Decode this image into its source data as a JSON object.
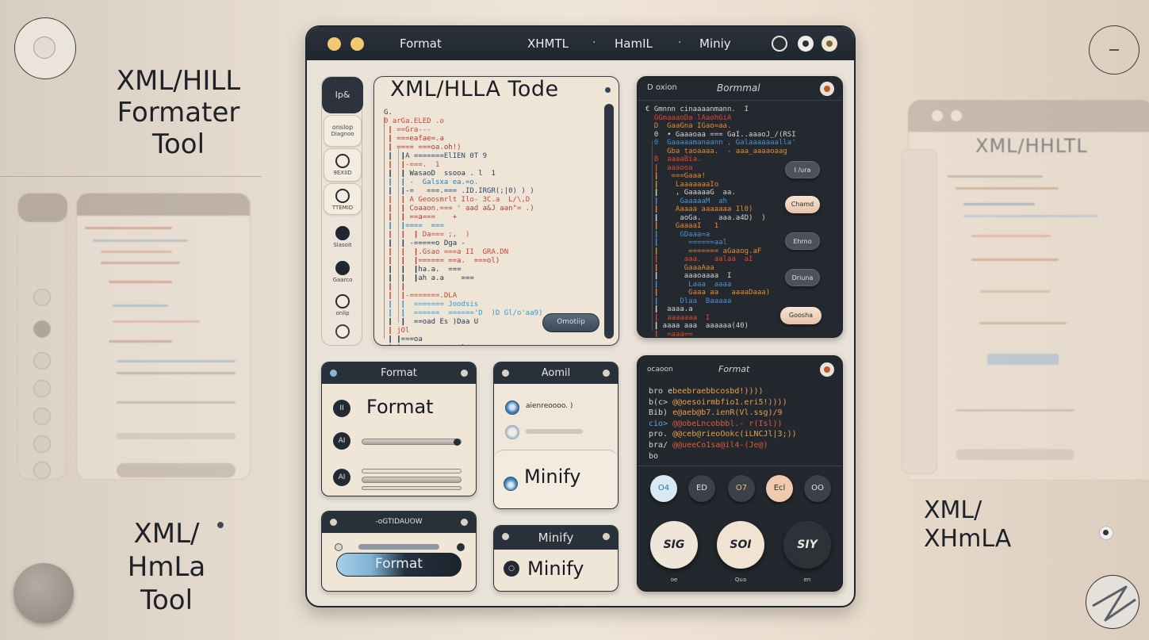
{
  "backdrop": {
    "left_heading": [
      "XML/HILL",
      "Formater",
      "Tool"
    ],
    "left_bottom_heading": [
      "XML/",
      "HmLa",
      "Tool"
    ],
    "right_ghost_title": "XML/HHLTL",
    "right_bottom_heading": [
      "XML/",
      "XHmLA"
    ]
  },
  "window": {
    "toolbar": {
      "format_label": "Format",
      "tabs": [
        "XHMTL",
        "HamIL",
        "Miniy"
      ],
      "separator": "·",
      "icons": [
        "refresh-icon",
        "record-icon",
        "settings-icon"
      ]
    },
    "sidebar": {
      "top_label": "Ip&",
      "items": [
        {
          "label": "onslop",
          "sublabel": "Diagnoo",
          "icon": "text"
        },
        {
          "label": "9EXIID",
          "icon": "circle-outline"
        },
        {
          "label": "TTEMID",
          "icon": "circle-outline"
        },
        {
          "label": "Slasoit",
          "icon": "circle-filled"
        },
        {
          "label": "Gaarco",
          "icon": "circle-filled"
        },
        {
          "label": "onlip",
          "icon": "eye"
        },
        {
          "label": "",
          "icon": "swirl"
        }
      ]
    },
    "editor": {
      "title": "XML/HLLA Tode",
      "action_label": "Omotiip",
      "lines": [
        {
          "t": "G.",
          "c": "#333"
        },
        {
          "t": "0 arGa.ELED .o",
          "c": "#c2483a"
        },
        {
          "t": " ┃ ==Gra--- ",
          "c": "#c2483a"
        },
        {
          "t": " ┃ ===eafae=.a",
          "c": "#b5382c"
        },
        {
          "t": " ┃ ==== ===oa.oh!)",
          "c": "#a83a2e"
        },
        {
          "t": " ┃  ┃A =======ElIEN 0T 9",
          "c": "#2c4a6d"
        },
        {
          "t": " ┃  ┃-===.  1",
          "c": "#c2483a"
        },
        {
          "t": " ┃  ┃ WasaoD  ssooa . l  1",
          "c": "#1f3650"
        },
        {
          "t": " ┃  ┃ -  Galsxa ea.=o.",
          "c": "#2f7fb8"
        },
        {
          "t": " ┃  ┃-=   ===.=== .ID.IRGR(;|0) ) )",
          "c": "#2c4a6d"
        },
        {
          "t": " ┃  ┃ A Geoosmrlt Ilo- 3C.a  L/\\,D",
          "c": "#c2483a"
        },
        {
          "t": " ┃  ┃ Coaaon.=== ' aad a&J aan\"= .)",
          "c": "#a84236"
        },
        {
          "t": " ┃  ┃ ==a===    +",
          "c": "#b5382c"
        },
        {
          "t": " ┃  ┃====  ===",
          "c": "#2f7fb8"
        },
        {
          "t": " ┃  ┃  ┃ Da=== ;,  )",
          "c": "#c2483a"
        },
        {
          "t": " ┃  ┃ -=====o Dga -",
          "c": "#1f3650"
        },
        {
          "t": " ┃  ┃  ┃.Gsao ===a II  GRA.DN",
          "c": "#c2483a"
        },
        {
          "t": " ┃  ┃  ┃====== ==a.  ===ol)",
          "c": "#b5382c"
        },
        {
          "t": " ┃  ┃  ┃ha.a.  ===",
          "c": "#1f3650"
        },
        {
          "t": " ┃  ┃  ┃ah a.a    ===",
          "c": "#1f3650"
        },
        {
          "t": " ┃  ┃",
          "c": "#a84236"
        },
        {
          "t": " ┃  ┃-=======.DLA",
          "c": "#c2483a"
        },
        {
          "t": " ┃  ┃  ======= Joodsis",
          "c": "#2f9bd0"
        },
        {
          "t": " ┃  ┃  ======  ======'D  )D Gl/o'aa9)",
          "c": "#2f9bd0"
        },
        {
          "t": " ┃  ┃  ==oad Es )Daa U",
          "c": "#1f3650"
        },
        {
          "t": " ┃ jOl",
          "c": "#c2483a"
        },
        {
          "t": " ┃ ┃===oa",
          "c": "#1f3650"
        },
        {
          "t": " ┃ ┃=aa  ===== ' 'l/osa",
          "c": "#2f7fb8"
        }
      ]
    },
    "output_panel": {
      "header_left": "D oxion",
      "header_center": "Bormmal",
      "buttons": [
        {
          "label": "I /ura",
          "style": "dark"
        },
        {
          "label": "Chamd",
          "style": "light"
        },
        {
          "label": "Ehrno",
          "style": "dark"
        },
        {
          "label": "Driuna",
          "style": "dark"
        },
        {
          "label": "Goosha",
          "style": "light"
        }
      ],
      "lines": [
        {
          "t": "€ Gmnnn cinaaaanmann.  I",
          "c": "#d8d4cf"
        },
        {
          "t": "  GGmaaaoDa lAaohGiA",
          "c": "#e0472f"
        },
        {
          "t": "  D  GaaGna IGao=aa.",
          "c": "#e68a2e"
        },
        {
          "t": "  0  • Gaaaoaa === GaI..aaaoJ_/(RSI)",
          "c": "#d8d4cf"
        },
        {
          "t": "  0  Gaaaaamanaann , Galaaaaaaalla', ",
          "c": "#4f8fd0"
        },
        {
          "t": "     Gba taoaaaa.  - aaa_aaaaoaag ",
          "c": "#e68a2e"
        },
        {
          "t": "  B  aaaaBia.",
          "c": "#e0472f"
        },
        {
          "t": "  ┃  aaaooa",
          "c": "#e0472f"
        },
        {
          "t": "  ┃   ===Gaaa!",
          "c": "#e68a2e"
        },
        {
          "t": "  ┃    LaaaaaaaIo",
          "c": "#e68a2e"
        },
        {
          "t": "  ┃    , GaaaaaG  aa.",
          "c": "#d8d4cf"
        },
        {
          "t": "  ┃     GaaaaaM  ah",
          "c": "#4f8fd0"
        },
        {
          "t": "  ┃    Aaaaa aaaaaaa Il0)",
          "c": "#e68a2e"
        },
        {
          "t": "  ┃     aoGa.    aaa.a4D)  )",
          "c": "#d8d4cf"
        },
        {
          "t": "  ┃    GaaaaI   1",
          "c": "#e68a2e"
        },
        {
          "t": "  ┃     GDaaa=a",
          "c": "#4f8fd0"
        },
        {
          "t": "  ┃       ======aal",
          "c": "#4f8fd0"
        },
        {
          "t": "  ┃       ======= aGaaog.aF",
          "c": "#e68a2e"
        },
        {
          "t": "  ┃      aaa.   aalaa  aI",
          "c": "#e0472f"
        },
        {
          "t": "  ┃      GaaaAaa   ",
          "c": "#e68a2e"
        },
        {
          "t": "  ┃      aaaoaaaa  I",
          "c": "#d8d4cf"
        },
        {
          "t": "  ┃       Laaa  aaaa",
          "c": "#4f8fd0"
        },
        {
          "t": "  ┃       Gaaa aa   aaaaDaaa)",
          "c": "#e68a2e"
        },
        {
          "t": "  ┃     Dlaa  Baaaaa",
          "c": "#4f8fd0"
        },
        {
          "t": "  ┃  aaaa.a",
          "c": "#d8d4cf"
        },
        {
          "t": "  ┃  aaaaaaa  I",
          "c": "#e0472f"
        },
        {
          "t": "  ┃ aaaa aaa  aaaaaa(40)",
          "c": "#d8d4cf"
        },
        {
          "t": "  ┃  =aaa==",
          "c": "#e0472f"
        }
      ]
    },
    "format_card": {
      "header": "Format",
      "big_label": "Format",
      "row_icons": [
        "II",
        "AI",
        "AI"
      ]
    },
    "hamil_card": {
      "header": "Aomil",
      "option_text": "aienreoooo. )",
      "big_label": "Minify"
    },
    "format_card2": {
      "header": "-oGTIDAUOW",
      "button_label": "Format"
    },
    "minify_card": {
      "header": "Minify",
      "big_label": "Minify"
    },
    "console_panel": {
      "header_left": "ocaoon",
      "header_center": "Format",
      "lines": [
        {
          "t": "bro ebeebraebbcosbd!))))",
          "c": [
            "#d9d4cc",
            "#e9a04a"
          ]
        },
        {
          "t": "b(c> @@oesoirmbfio1.eri5!))))",
          "c": [
            "#d9d4cc",
            "#e9a04a"
          ]
        },
        {
          "t": "Bib) e@aeb@b7.ienR(Vl.ssg)/9",
          "c": [
            "#d9d4cc",
            "#e9a04a"
          ]
        },
        {
          "t": "cio> @@obeLncobbbl.- r(Isl))",
          "c": [
            "#6aa6d8",
            "#e05b3b"
          ]
        },
        {
          "t": "pro. @@ceb@rieoOokc(iLNCJl|3;))",
          "c": [
            "#d9d4cc",
            "#e9a04a"
          ]
        },
        {
          "t": "bra/ @@ueeCo1sa@il4-(Je@)",
          "c": [
            "#d9d4cc",
            "#e05b3b"
          ]
        },
        {
          "t": "bo  ",
          "c": [
            "#d9d4cc",
            "#d9d4cc"
          ]
        }
      ],
      "round_buttons": [
        {
          "label": "O4",
          "bg": "#d7e9f2",
          "fg": "#2d79a8"
        },
        {
          "label": "ED",
          "bg": "#3b4149",
          "fg": "#e4e1dc"
        },
        {
          "label": "O7",
          "bg": "#3b4149",
          "fg": "#e8c27a"
        },
        {
          "label": "Ecl",
          "bg": "#f0c9ae",
          "fg": "#2b2b2b"
        },
        {
          "label": "OO",
          "bg": "#3b4149",
          "fg": "#e4e1dc"
        }
      ],
      "big_buttons": [
        {
          "label": "SIG",
          "caption": "oe",
          "bg": "#efe5d8",
          "fg": "#1f2430"
        },
        {
          "label": "SOI",
          "caption": "Qua",
          "bg": "#f1e3d2",
          "fg": "#1f2430"
        },
        {
          "label": "SIY",
          "caption": "en",
          "bg": "#2d3239",
          "fg": "#e9e6e0"
        }
      ]
    }
  }
}
